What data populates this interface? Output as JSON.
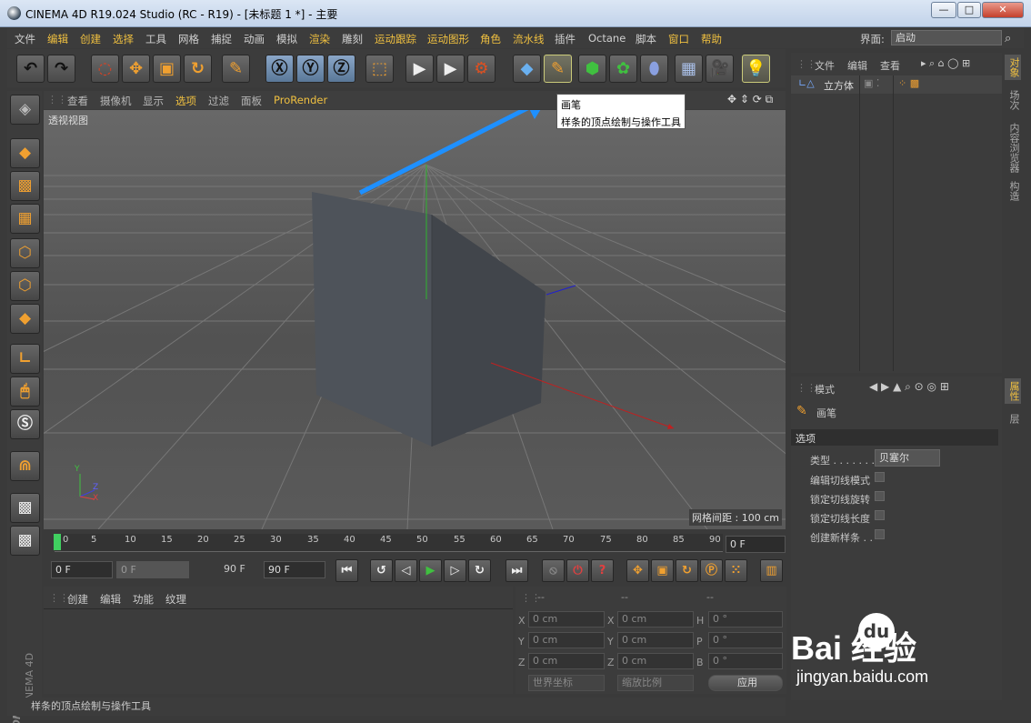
{
  "window": {
    "title": "CINEMA 4D R19.024 Studio (RC - R19) - [未标题 1 *] - 主要",
    "btn_min": "—",
    "btn_max": "□",
    "btn_close": "✕"
  },
  "menu": {
    "items": [
      "文件",
      "编辑",
      "创建",
      "选择",
      "工具",
      "网格",
      "捕捉",
      "动画",
      "模拟",
      "渲染",
      "雕刻",
      "运动跟踪",
      "运动图形",
      "角色",
      "流水线",
      "插件",
      "Octane",
      "脚本",
      "窗口",
      "帮助"
    ],
    "layout_label": "界面:",
    "layout_value": "启动"
  },
  "viewport": {
    "menu": [
      "查看",
      "摄像机",
      "显示",
      "选项",
      "过滤",
      "面板",
      "ProRender"
    ],
    "name": "透视视图",
    "grid_info": "网格间距 : 100 cm",
    "axis": {
      "y": "Y",
      "z": "Z",
      "x": "X"
    }
  },
  "tooltip": {
    "title": "画笔",
    "desc": "样条的顶点绘制与操作工具"
  },
  "timeline": {
    "ticks": [
      "0",
      "5",
      "10",
      "15",
      "20",
      "25",
      "30",
      "35",
      "40",
      "45",
      "50",
      "55",
      "60",
      "65",
      "70",
      "75",
      "80",
      "85",
      "90"
    ],
    "frame": "0 F"
  },
  "transport": {
    "start": "0 F",
    "range_start": "0 F",
    "range_end": "90 F",
    "end": "90 F"
  },
  "material": {
    "menu": [
      "创建",
      "编辑",
      "功能",
      "纹理"
    ]
  },
  "coords": {
    "headers": [
      "--",
      "--",
      "--"
    ],
    "rows": [
      {
        "l1": "X",
        "v1": "0 cm",
        "l2": "X",
        "v2": "0 cm",
        "l3": "H",
        "v3": "0 °"
      },
      {
        "l1": "Y",
        "v1": "0 cm",
        "l2": "Y",
        "v2": "0 cm",
        "l3": "P",
        "v3": "0 °"
      },
      {
        "l1": "Z",
        "v1": "0 cm",
        "l2": "Z",
        "v2": "0 cm",
        "l3": "B",
        "v3": "0 °"
      }
    ],
    "world": "世界坐标",
    "scale": "缩放比例",
    "apply": "应用"
  },
  "status": {
    "text": "样条的顶点绘制与操作工具"
  },
  "objects": {
    "menu": [
      "文件",
      "编辑",
      "查看"
    ],
    "items": [
      {
        "name": "立方体"
      }
    ]
  },
  "attributes": {
    "mode": "模式",
    "tool": "画笔",
    "section": "选项",
    "type_label": "类型 . . . . . . .",
    "type_value": "贝塞尔",
    "options": [
      "编辑切线模式",
      "锁定切线旋转",
      "锁定切线长度",
      "创建新样条 . ."
    ]
  },
  "right_tabs": [
    "对象",
    "场次",
    "内容浏览器",
    "构造",
    "属性",
    "层"
  ],
  "brand": {
    "maxon": "MAXON",
    "c4d": "CINEMA 4D"
  },
  "watermark": {
    "text": "Bai  经验",
    "url": "jingyan.baidu.com",
    "du": "du"
  },
  "colors": {
    "accent": "#f0c040",
    "selection": "#5a7898",
    "tooltip_arrow": "#1e90ff"
  }
}
